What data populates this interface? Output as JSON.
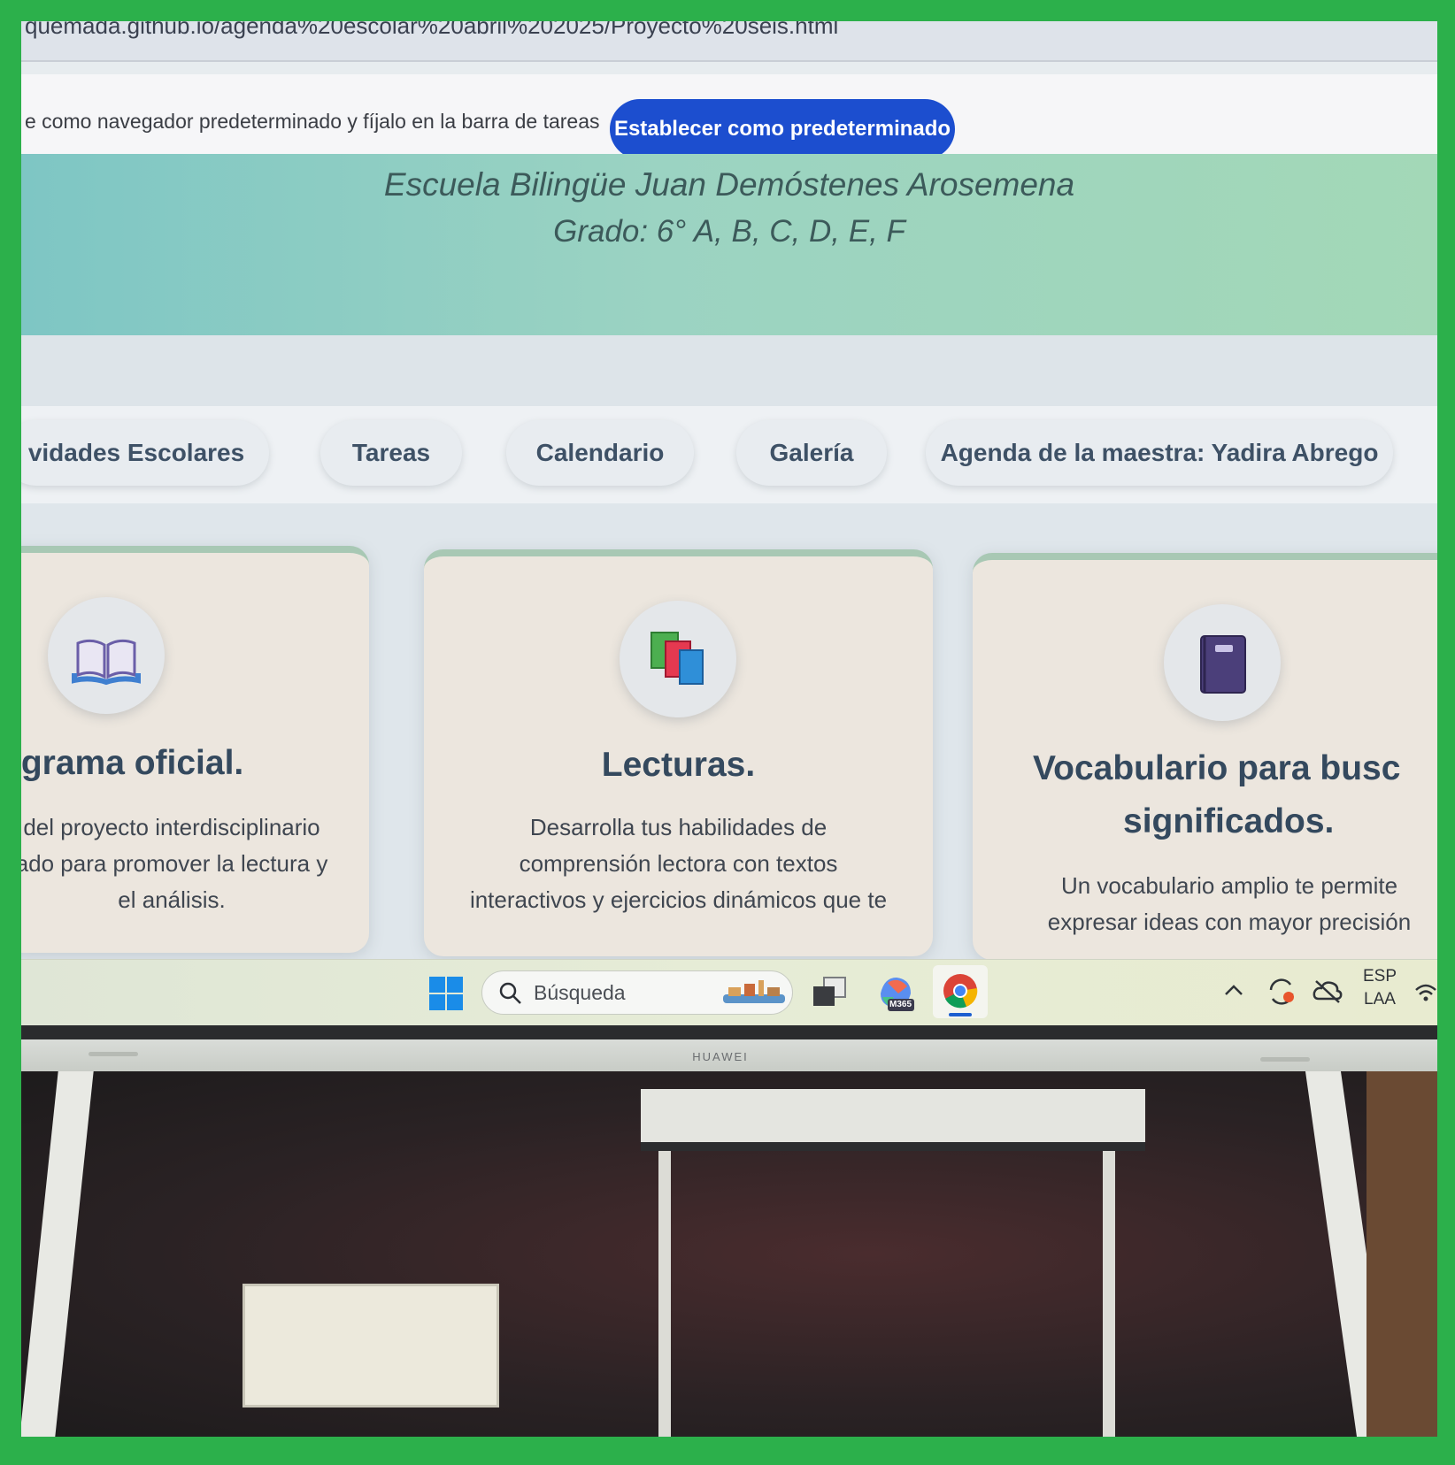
{
  "browser": {
    "url_fragment": "quemada.github.io/agenda%20escolar%20abril%202025/Proyecto%20seis.html"
  },
  "default_bar": {
    "message": "e como navegador predeterminado y fíjalo en la barra de tareas",
    "button_label": "Establecer como predeterminado"
  },
  "hero": {
    "school": "Escuela Bilingüe Juan Demóstenes Arosemena",
    "grade": "Grado: 6° A, B, C, D, E, F"
  },
  "nav": {
    "items": [
      {
        "label": "vidades Escolares"
      },
      {
        "label": "Tareas"
      },
      {
        "label": "Calendario"
      },
      {
        "label": "Galería"
      },
      {
        "label": "Agenda de la maestra: Yadira Abrego"
      }
    ]
  },
  "cards": [
    {
      "icon": "open-book-icon",
      "title": "ograma oficial.",
      "lines": [
        "del proyecto interdisciplinario",
        "ado para promover la lectura y",
        "el análisis."
      ]
    },
    {
      "icon": "stacked-books-icon",
      "title": "Lecturas.",
      "lines": [
        "Desarrolla tus habilidades de",
        "comprensión lectora con textos",
        "interactivos y ejercicios dinámicos que te"
      ]
    },
    {
      "icon": "notebook-icon",
      "title_lines": [
        "Vocabulario para busc",
        "significados."
      ],
      "lines": [
        "Un vocabulario amplio te permite",
        "expresar ideas con mayor precisión"
      ]
    }
  ],
  "taskbar": {
    "search_placeholder": "Búsqueda",
    "copilot_badge": "M365",
    "lang_top": "ESP",
    "lang_bottom": "LAA"
  },
  "monitor": {
    "brand": "HUAWEI"
  },
  "colors": {
    "frame": "#2cb04b",
    "primary_button": "#1c4ecf",
    "heading": "#34495e"
  }
}
